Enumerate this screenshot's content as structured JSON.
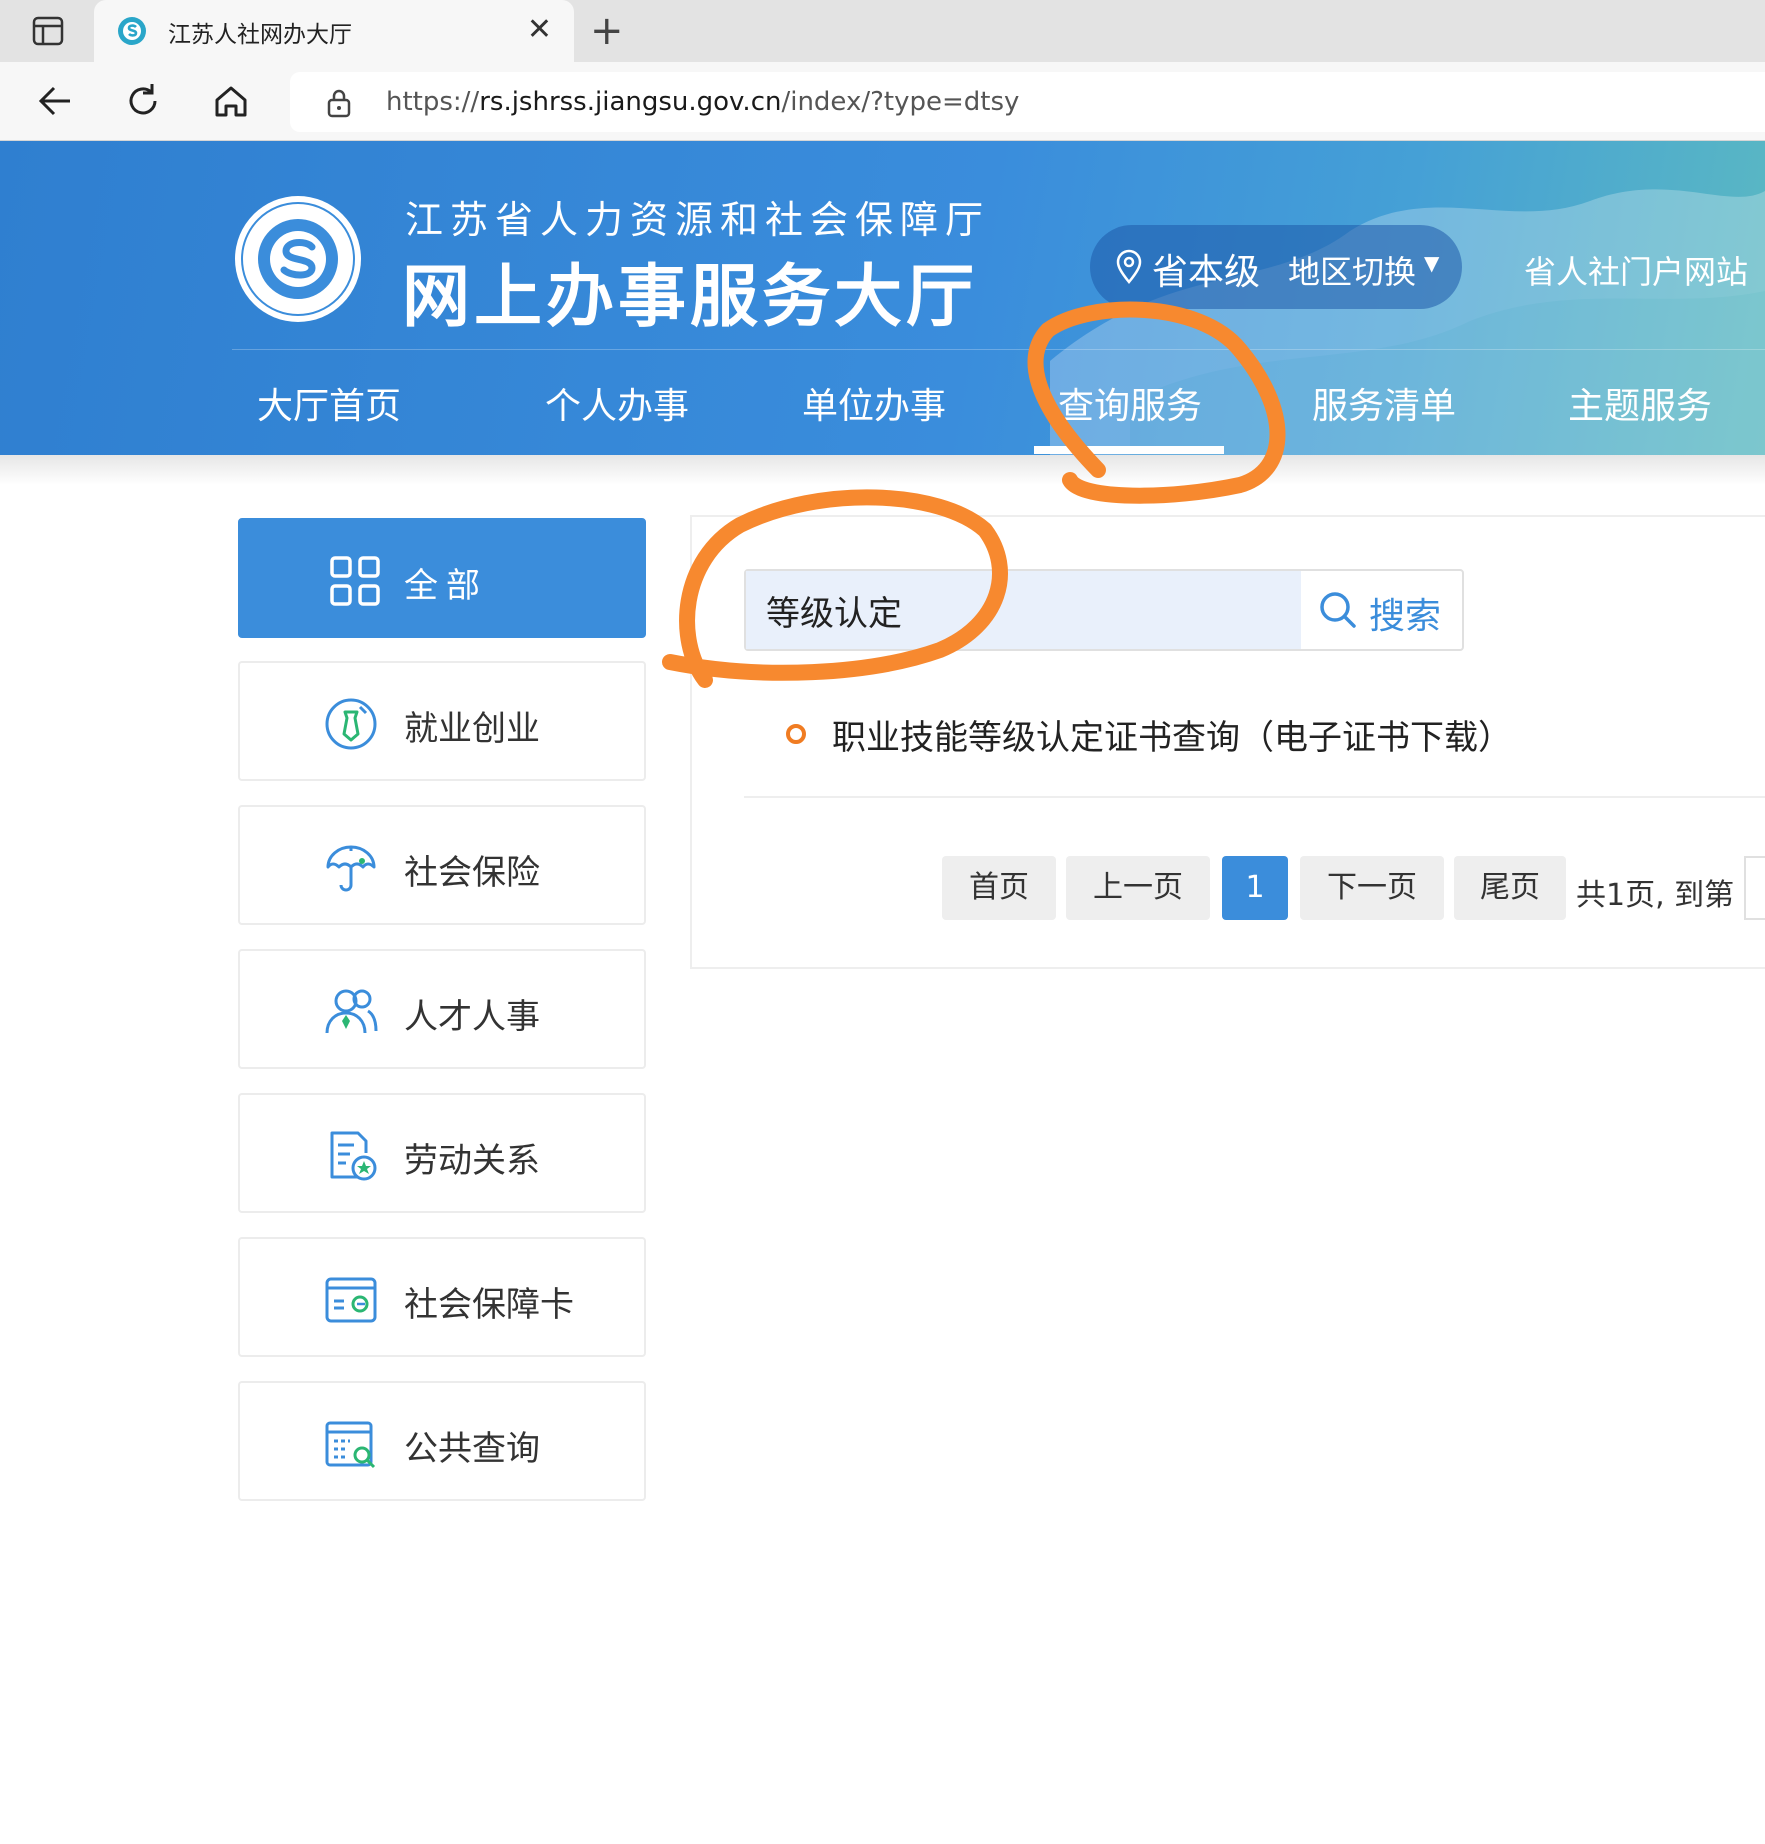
{
  "browser": {
    "tab_title": "江苏人社网办大厅",
    "tab_close": "✕",
    "new_tab": "+",
    "url_scheme": "https://",
    "url_host": "rs.jshrss.jiangsu.gov.cn",
    "url_path": "/index/?type=dtsy"
  },
  "header": {
    "subtitle": "江苏省人力资源和社会保障厅",
    "title": "网上办事服务大厅",
    "region_name": "省本级",
    "region_switch": "地区切换",
    "region_caret": "▼",
    "portal_link": "省人社门户网站",
    "nav": [
      "大厅首页",
      "个人办事",
      "单位办事",
      "查询服务",
      "服务清单",
      "主题服务"
    ],
    "active_nav": "查询服务"
  },
  "categories": [
    {
      "label": "全部",
      "icon": "grid-icon",
      "active": true
    },
    {
      "label": "就业创业",
      "icon": "employment-icon"
    },
    {
      "label": "社会保险",
      "icon": "umbrella-icon"
    },
    {
      "label": "人才人事",
      "icon": "people-icon"
    },
    {
      "label": "劳动关系",
      "icon": "document-star-icon"
    },
    {
      "label": "社会保障卡",
      "icon": "card-icon"
    },
    {
      "label": "公共查询",
      "icon": "search-document-icon"
    }
  ],
  "search": {
    "value": "等级认定",
    "button_label": "搜索"
  },
  "results": [
    {
      "text": "职业技能等级认定证书查询（电子证书下载）"
    }
  ],
  "pagination": {
    "first": "首页",
    "prev": "上一页",
    "current": "1",
    "next": "下一页",
    "last": "尾页",
    "summary": "共1页, 到第"
  },
  "colors": {
    "brand_blue": "#3b8ddb",
    "annotation_orange": "#f7892f",
    "bullet_orange": "#f07c22"
  }
}
